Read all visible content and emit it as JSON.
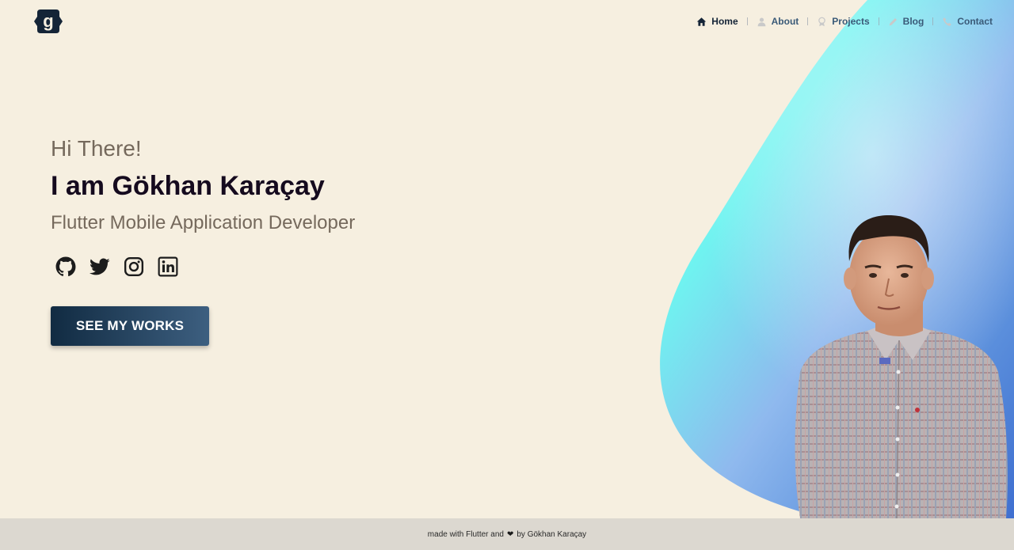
{
  "brand": {
    "logo_letter": "g",
    "logo_color": "#142437"
  },
  "nav": {
    "items": [
      {
        "label": "Home",
        "icon": "home-icon",
        "active": true
      },
      {
        "label": "About",
        "icon": "person-icon",
        "active": false
      },
      {
        "label": "Projects",
        "icon": "badge-icon",
        "active": false
      },
      {
        "label": "Blog",
        "icon": "pencil-icon",
        "active": false
      },
      {
        "label": "Contact",
        "icon": "phone-icon",
        "active": false
      }
    ]
  },
  "hero": {
    "greeting": "Hi There!",
    "name": "I am Gökhan Karaçay",
    "role": "Flutter Mobile Application Developer",
    "cta_label": "SEE MY WORKS"
  },
  "socials": [
    {
      "icon": "github-icon"
    },
    {
      "icon": "twitter-icon"
    },
    {
      "icon": "instagram-icon"
    },
    {
      "icon": "linkedin-icon"
    }
  ],
  "footer": {
    "prefix": "made with Flutter and",
    "suffix": "by Gökhan Karaçay"
  },
  "colors": {
    "background": "#f6efe0",
    "accent_dark": "#112b42",
    "accent_light": "#3d5f80",
    "blob_cyan": "#6ff3f0",
    "blob_blue": "#5b8fdc"
  }
}
